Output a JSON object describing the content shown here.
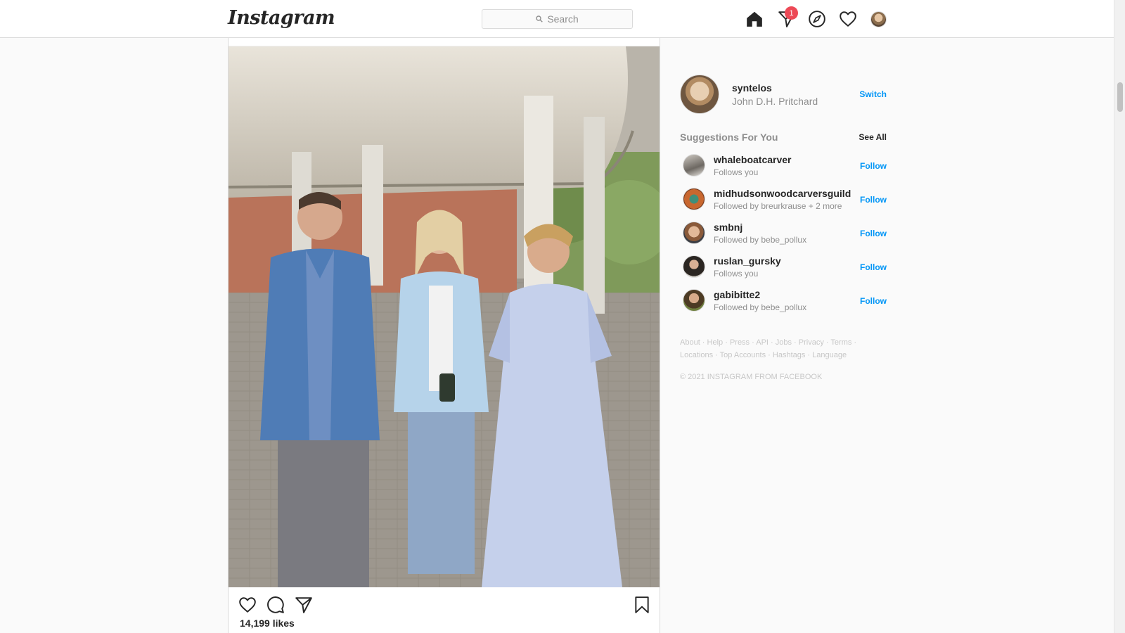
{
  "header": {
    "logo": "Instagram",
    "search_placeholder": "Search",
    "notification_count": "1",
    "icons": [
      "home-icon",
      "direct-icon",
      "explore-icon",
      "activity-heart-icon"
    ]
  },
  "post": {
    "likes": "14,199 likes",
    "image_alt": "Three people posing in front of a building with white columns"
  },
  "sidebar": {
    "username": "syntelos",
    "full_name": "John D.H. Pritchard",
    "switch_label": "Switch",
    "suggestions_title": "Suggestions For You",
    "see_all": "See All",
    "suggestions": [
      {
        "username": "whaleboatcarver",
        "subtitle": "Follows you",
        "action": "Follow"
      },
      {
        "username": "midhudsonwoodcarversguild",
        "subtitle": "Followed by breurkrause + 2 more",
        "action": "Follow"
      },
      {
        "username": "smbnj",
        "subtitle": "Followed by bebe_pollux",
        "action": "Follow"
      },
      {
        "username": "ruslan_gursky",
        "subtitle": "Follows you",
        "action": "Follow"
      },
      {
        "username": "gabibitte2",
        "subtitle": "Followed by bebe_pollux",
        "action": "Follow"
      }
    ],
    "footer_links": [
      "About",
      "Help",
      "Press",
      "API",
      "Jobs",
      "Privacy",
      "Terms",
      "Locations",
      "Top Accounts",
      "Hashtags",
      "Language"
    ],
    "copyright": "© 2021 INSTAGRAM FROM FACEBOOK"
  },
  "colors": {
    "accent": "#0095f6",
    "badge": "#ed4956",
    "text": "#262626",
    "muted": "#8e8e8e"
  }
}
